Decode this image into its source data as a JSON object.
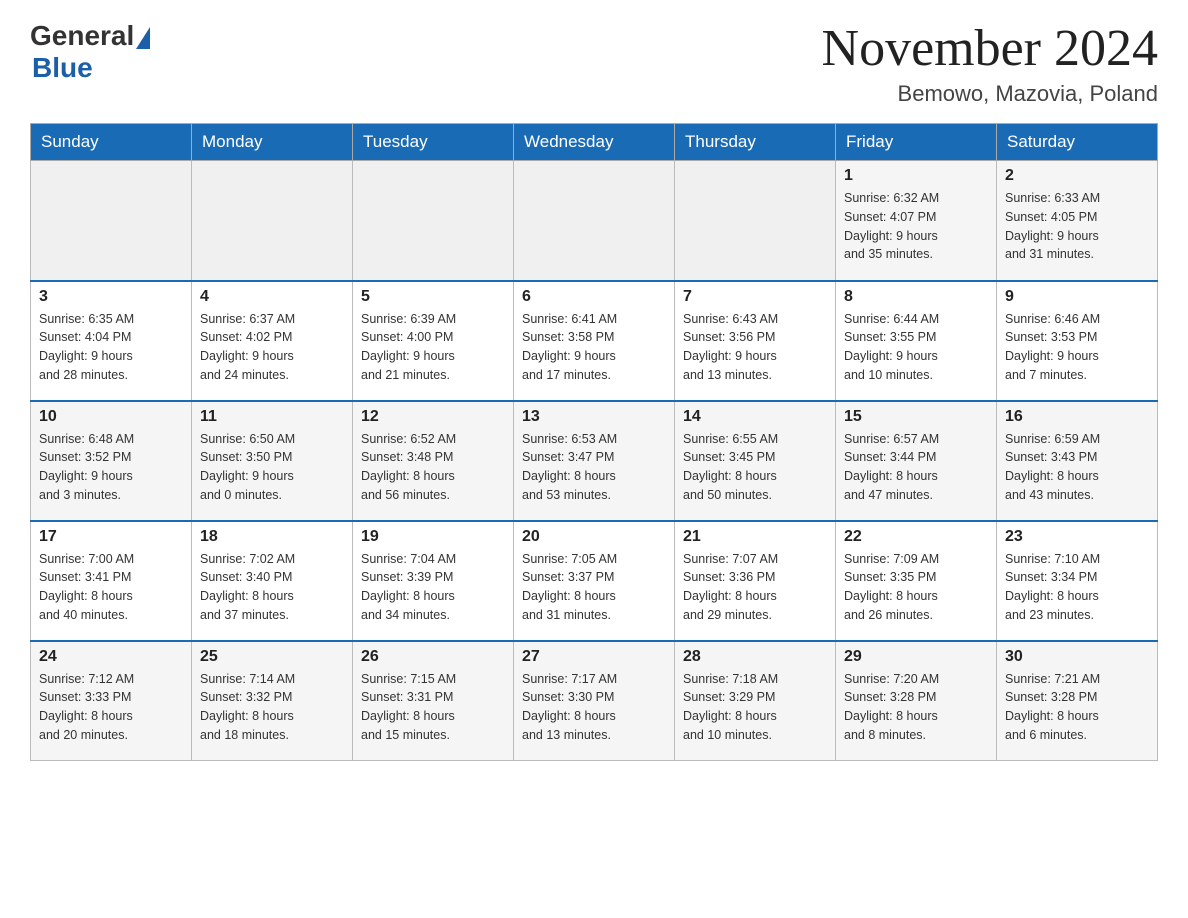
{
  "header": {
    "logo_general": "General",
    "logo_blue": "Blue",
    "month_title": "November 2024",
    "location": "Bemowo, Mazovia, Poland"
  },
  "weekdays": [
    "Sunday",
    "Monday",
    "Tuesday",
    "Wednesday",
    "Thursday",
    "Friday",
    "Saturday"
  ],
  "weeks": [
    [
      {
        "day": "",
        "info": ""
      },
      {
        "day": "",
        "info": ""
      },
      {
        "day": "",
        "info": ""
      },
      {
        "day": "",
        "info": ""
      },
      {
        "day": "",
        "info": ""
      },
      {
        "day": "1",
        "info": "Sunrise: 6:32 AM\nSunset: 4:07 PM\nDaylight: 9 hours\nand 35 minutes."
      },
      {
        "day": "2",
        "info": "Sunrise: 6:33 AM\nSunset: 4:05 PM\nDaylight: 9 hours\nand 31 minutes."
      }
    ],
    [
      {
        "day": "3",
        "info": "Sunrise: 6:35 AM\nSunset: 4:04 PM\nDaylight: 9 hours\nand 28 minutes."
      },
      {
        "day": "4",
        "info": "Sunrise: 6:37 AM\nSunset: 4:02 PM\nDaylight: 9 hours\nand 24 minutes."
      },
      {
        "day": "5",
        "info": "Sunrise: 6:39 AM\nSunset: 4:00 PM\nDaylight: 9 hours\nand 21 minutes."
      },
      {
        "day": "6",
        "info": "Sunrise: 6:41 AM\nSunset: 3:58 PM\nDaylight: 9 hours\nand 17 minutes."
      },
      {
        "day": "7",
        "info": "Sunrise: 6:43 AM\nSunset: 3:56 PM\nDaylight: 9 hours\nand 13 minutes."
      },
      {
        "day": "8",
        "info": "Sunrise: 6:44 AM\nSunset: 3:55 PM\nDaylight: 9 hours\nand 10 minutes."
      },
      {
        "day": "9",
        "info": "Sunrise: 6:46 AM\nSunset: 3:53 PM\nDaylight: 9 hours\nand 7 minutes."
      }
    ],
    [
      {
        "day": "10",
        "info": "Sunrise: 6:48 AM\nSunset: 3:52 PM\nDaylight: 9 hours\nand 3 minutes."
      },
      {
        "day": "11",
        "info": "Sunrise: 6:50 AM\nSunset: 3:50 PM\nDaylight: 9 hours\nand 0 minutes."
      },
      {
        "day": "12",
        "info": "Sunrise: 6:52 AM\nSunset: 3:48 PM\nDaylight: 8 hours\nand 56 minutes."
      },
      {
        "day": "13",
        "info": "Sunrise: 6:53 AM\nSunset: 3:47 PM\nDaylight: 8 hours\nand 53 minutes."
      },
      {
        "day": "14",
        "info": "Sunrise: 6:55 AM\nSunset: 3:45 PM\nDaylight: 8 hours\nand 50 minutes."
      },
      {
        "day": "15",
        "info": "Sunrise: 6:57 AM\nSunset: 3:44 PM\nDaylight: 8 hours\nand 47 minutes."
      },
      {
        "day": "16",
        "info": "Sunrise: 6:59 AM\nSunset: 3:43 PM\nDaylight: 8 hours\nand 43 minutes."
      }
    ],
    [
      {
        "day": "17",
        "info": "Sunrise: 7:00 AM\nSunset: 3:41 PM\nDaylight: 8 hours\nand 40 minutes."
      },
      {
        "day": "18",
        "info": "Sunrise: 7:02 AM\nSunset: 3:40 PM\nDaylight: 8 hours\nand 37 minutes."
      },
      {
        "day": "19",
        "info": "Sunrise: 7:04 AM\nSunset: 3:39 PM\nDaylight: 8 hours\nand 34 minutes."
      },
      {
        "day": "20",
        "info": "Sunrise: 7:05 AM\nSunset: 3:37 PM\nDaylight: 8 hours\nand 31 minutes."
      },
      {
        "day": "21",
        "info": "Sunrise: 7:07 AM\nSunset: 3:36 PM\nDaylight: 8 hours\nand 29 minutes."
      },
      {
        "day": "22",
        "info": "Sunrise: 7:09 AM\nSunset: 3:35 PM\nDaylight: 8 hours\nand 26 minutes."
      },
      {
        "day": "23",
        "info": "Sunrise: 7:10 AM\nSunset: 3:34 PM\nDaylight: 8 hours\nand 23 minutes."
      }
    ],
    [
      {
        "day": "24",
        "info": "Sunrise: 7:12 AM\nSunset: 3:33 PM\nDaylight: 8 hours\nand 20 minutes."
      },
      {
        "day": "25",
        "info": "Sunrise: 7:14 AM\nSunset: 3:32 PM\nDaylight: 8 hours\nand 18 minutes."
      },
      {
        "day": "26",
        "info": "Sunrise: 7:15 AM\nSunset: 3:31 PM\nDaylight: 8 hours\nand 15 minutes."
      },
      {
        "day": "27",
        "info": "Sunrise: 7:17 AM\nSunset: 3:30 PM\nDaylight: 8 hours\nand 13 minutes."
      },
      {
        "day": "28",
        "info": "Sunrise: 7:18 AM\nSunset: 3:29 PM\nDaylight: 8 hours\nand 10 minutes."
      },
      {
        "day": "29",
        "info": "Sunrise: 7:20 AM\nSunset: 3:28 PM\nDaylight: 8 hours\nand 8 minutes."
      },
      {
        "day": "30",
        "info": "Sunrise: 7:21 AM\nSunset: 3:28 PM\nDaylight: 8 hours\nand 6 minutes."
      }
    ]
  ]
}
